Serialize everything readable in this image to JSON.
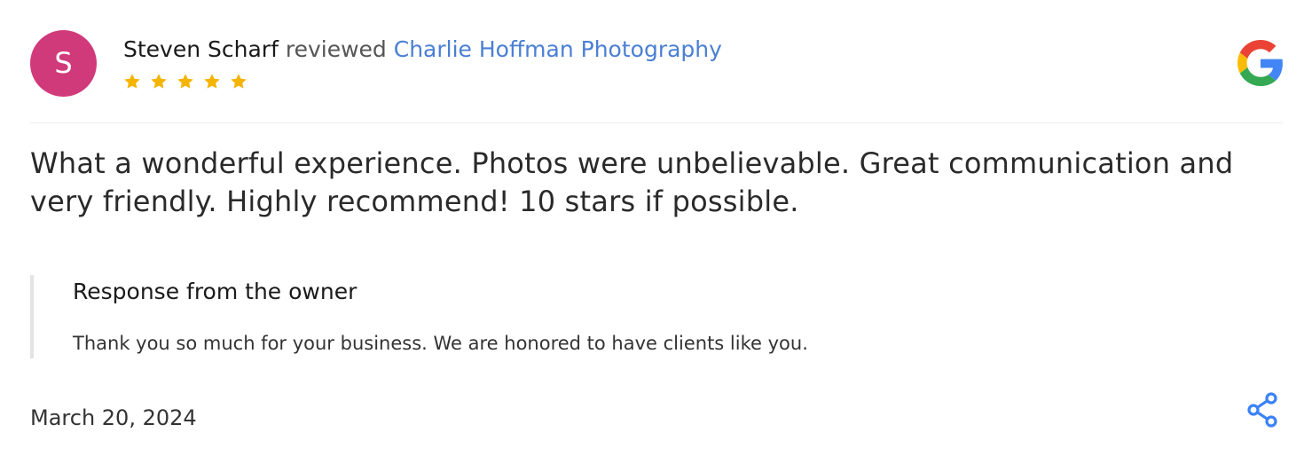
{
  "review": {
    "avatar_initial": "S",
    "reviewer_name": "Steven Scharf",
    "reviewed_word": "reviewed",
    "business_name": "Charlie Hoffman Photography",
    "rating": 5,
    "rating_max": 5,
    "text": "What a wonderful experience. Photos were unbelievable. Great communication and very friendly. Highly recommend! 10 stars if possible.",
    "date": "March 20, 2024"
  },
  "owner_response": {
    "title": "Response from the owner",
    "text": "Thank you so much for your business. We are honored to have clients like you."
  },
  "icons": {
    "platform": "google-icon",
    "share": "share-icon",
    "star": "star-icon"
  },
  "colors": {
    "avatar_bg": "#d13a7a",
    "link": "#4a7fd4",
    "star": "#f4b400",
    "share": "#3b82f6"
  }
}
